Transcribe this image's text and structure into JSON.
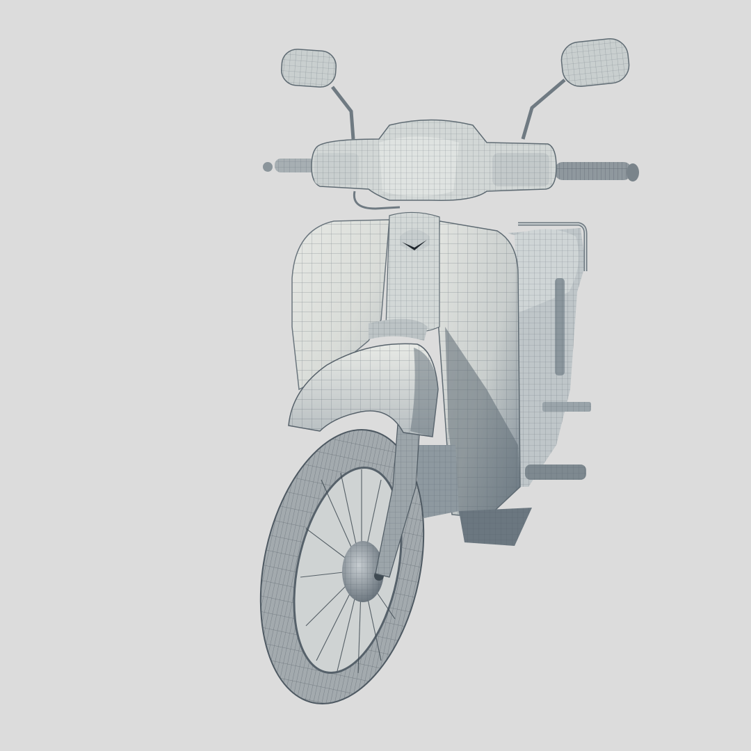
{
  "scene": {
    "subject": "wireframe-scooter-render"
  },
  "colors": {
    "background": "#dcdcdc",
    "body_light": "#e4e6e2",
    "body_mid": "#c8cdcc",
    "body_shade": "#8996a0",
    "shadow_dark": "#5a6670",
    "wire": "#4a5560",
    "edge": "#3a444c",
    "tire": "#9aa0a4",
    "tire_dark": "#5d666e"
  }
}
